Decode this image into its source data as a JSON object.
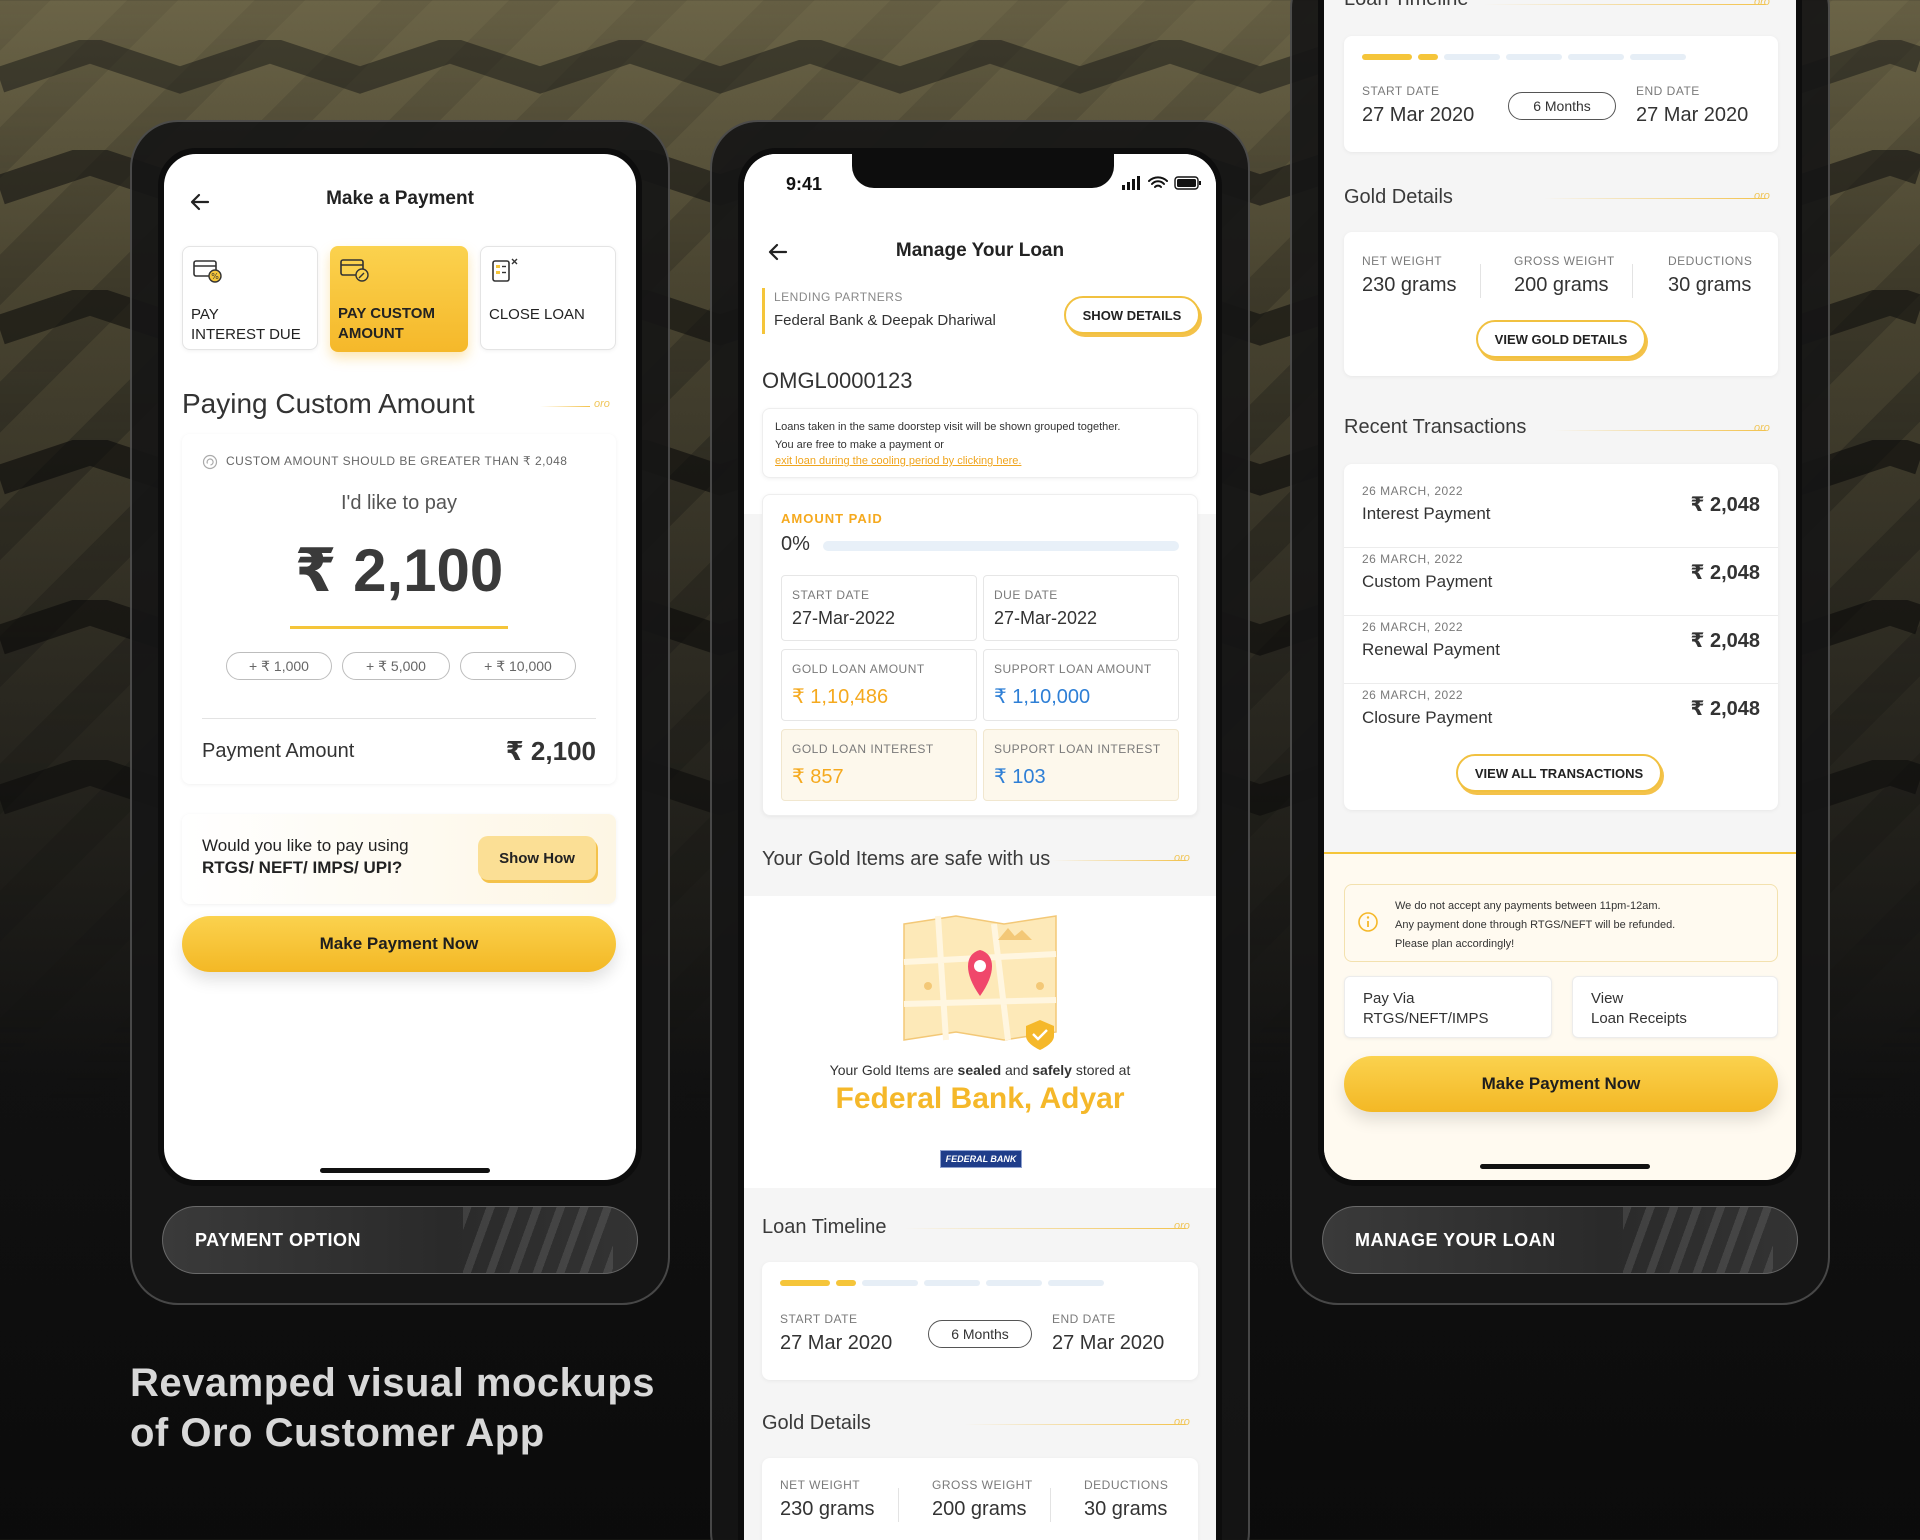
{
  "tagline": {
    "line1": "Revamped visual mockups",
    "line2": "of Oro Customer App"
  },
  "labels": {
    "payment_option": "PAYMENT OPTION",
    "manage_your_loan": "MANAGE YOUR LOAN"
  },
  "payment": {
    "header_title": "Make a Payment",
    "options": [
      {
        "label": "PAY\nINTEREST DUE",
        "l1": "PAY",
        "l2": "INTEREST DUE"
      },
      {
        "l1": "PAY CUSTOM",
        "l2": "AMOUNT"
      },
      {
        "l1": "CLOSE LOAN"
      }
    ],
    "section_title": "Paying Custom Amount",
    "oro_mark": "oro",
    "notice": "CUSTOM AMOUNT SHOULD BE GREATER THAN ₹ 2,048",
    "prompt": "I'd like to pay",
    "amount": "₹ 2,100",
    "chips": [
      "+ ₹ 1,000",
      "+ ₹ 5,000",
      "+ ₹ 10,000"
    ],
    "payment_amount_label": "Payment Amount",
    "payment_amount_value": "₹ 2,100",
    "rtgs_q1": "Would you like to pay using",
    "rtgs_q2": "RTGS/ NEFT/ IMPS/ UPI?",
    "show_how": "Show How",
    "make_payment": "Make Payment Now"
  },
  "manage": {
    "time": "9:41",
    "header_title": "Manage Your Loan",
    "lending_label": "LENDING PARTNERS",
    "lending_value": "Federal Bank & Deepak Dhariwal",
    "show_details": "SHOW DETAILS",
    "loan_id": "OMGL0000123",
    "note1": "Loans taken in the same doorstep visit will be shown grouped together.",
    "note2": "You are free to make a payment or",
    "note_link": "exit loan during the cooling period by clicking here.",
    "amount_paid_label": "AMOUNT PAID",
    "amount_paid_pct": "0%",
    "amount_paid_fraction": 0.0,
    "start_date_label": "START DATE",
    "start_date": "27-Mar-2022",
    "due_date_label": "DUE DATE",
    "due_date": "27-Mar-2022",
    "gold_loan_amount_label": "GOLD LOAN AMOUNT",
    "gold_loan_amount": "₹ 1,10,486",
    "support_loan_amount_label": "SUPPORT LOAN AMOUNT",
    "support_loan_amount": "₹ 1,10,000",
    "gold_loan_interest_label": "GOLD LOAN INTEREST",
    "gold_loan_interest": "₹ 857",
    "support_loan_interest_label": "SUPPORT LOAN INTEREST",
    "support_loan_interest": "₹ 103",
    "safe_title": "Your Gold Items are safe with us",
    "stored_pre": "Your Gold Items are ",
    "stored_b1": "sealed",
    "stored_mid": " and ",
    "stored_b2": "safely",
    "stored_post": " stored at",
    "branch": "Federal Bank, Adyar",
    "bank_logo": "FEDERAL BANK",
    "timeline_title": "Loan Timeline",
    "tl_start_label": "START DATE",
    "tl_start": "27 Mar 2020",
    "tl_duration": "6 Months",
    "tl_end_label": "END DATE",
    "tl_end": "27 Mar 2020",
    "gold_details_title": "Gold Details",
    "net_weight_label": "NET WEIGHT",
    "net_weight": "230 grams",
    "gross_weight_label": "GROSS WEIGHT",
    "gross_weight": "200 grams",
    "deductions_label": "DEDUCTIONS",
    "deductions": "30 grams"
  },
  "manage2": {
    "timeline_title": "Loan Timeline",
    "tl_start_label": "START DATE",
    "tl_start": "27 Mar 2020",
    "tl_duration": "6 Months",
    "tl_end_label": "END DATE",
    "tl_end": "27 Mar 2020",
    "gold_details_title": "Gold Details",
    "net_weight_label": "NET WEIGHT",
    "net_weight": "230 grams",
    "gross_weight_label": "GROSS WEIGHT",
    "gross_weight": "200 grams",
    "deductions_label": "DEDUCTIONS",
    "deductions": "30 grams",
    "view_gold_details": "VIEW GOLD DETAILS",
    "recent_title": "Recent Transactions",
    "transactions": [
      {
        "date": "26 MARCH, 2022",
        "type": "Interest Payment",
        "amount": "₹ 2,048"
      },
      {
        "date": "26 MARCH, 2022",
        "type": "Custom Payment",
        "amount": "₹ 2,048"
      },
      {
        "date": "26 MARCH, 2022",
        "type": "Renewal Payment",
        "amount": "₹ 2,048"
      },
      {
        "date": "26 MARCH, 2022",
        "type": "Closure Payment",
        "amount": "₹ 2,048"
      }
    ],
    "view_all": "VIEW ALL TRANSACTIONS",
    "warn1": "We do not accept any payments between 11pm-12am.",
    "warn2": "Any payment done through RTGS/NEFT will be refunded.",
    "warn3": "Please plan accordingly!",
    "pay_via_l1": "Pay Via",
    "pay_via_l2": "RTGS/NEFT/IMPS",
    "view_receipts_l1": "View",
    "view_receipts_l2": "Loan Receipts",
    "make_payment": "Make Payment Now"
  },
  "colors": {
    "accent": "#f5b82a",
    "gold_value": "#f5a91e",
    "blue_value": "#2e7fd6",
    "pin": "#f0476b"
  }
}
